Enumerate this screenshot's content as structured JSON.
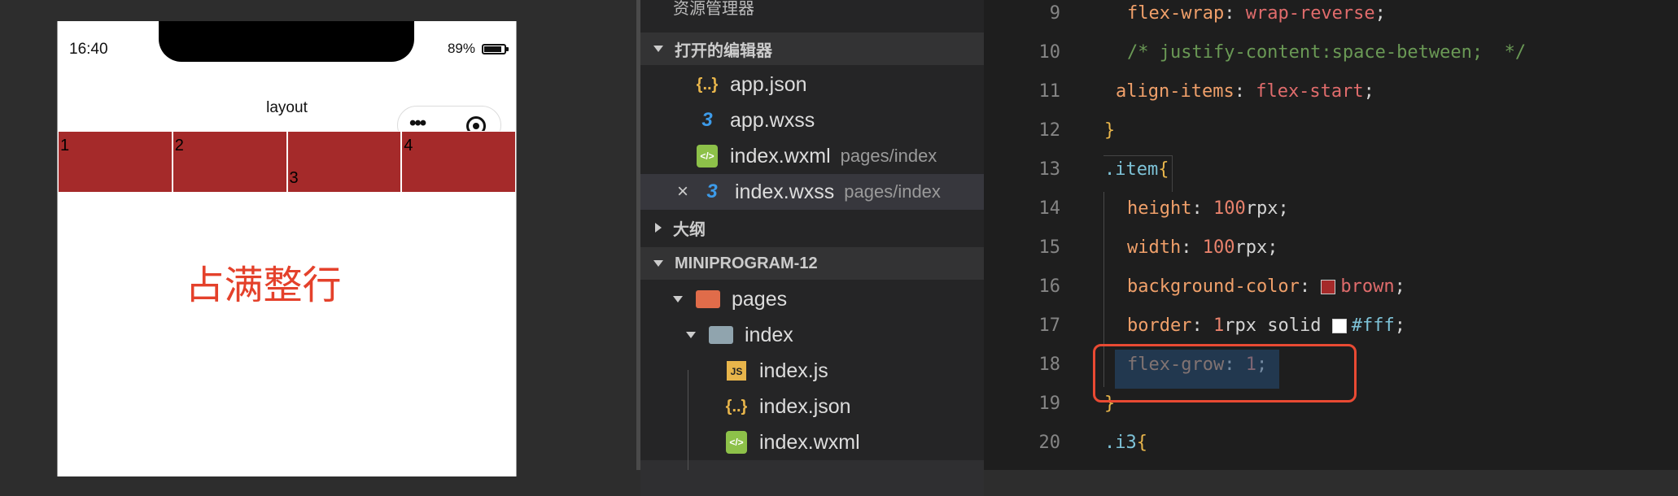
{
  "simulator": {
    "time": "16:40",
    "battery": "89%",
    "title": "layout",
    "items": [
      "1",
      "2",
      "3",
      "4"
    ],
    "caption": "占满整行",
    "colors": {
      "item_bg": "#a52a2a",
      "caption": "#e4412b"
    }
  },
  "explorer": {
    "title": "资源管理器",
    "open_editors_label": "打开的编辑器",
    "open_editors": [
      {
        "icon": "json-icon",
        "name": "app.json",
        "path": ""
      },
      {
        "icon": "css-icon",
        "name": "app.wxss",
        "path": ""
      },
      {
        "icon": "wxml-icon",
        "name": "index.wxml",
        "path": "pages/index"
      },
      {
        "icon": "css-icon",
        "name": "index.wxss",
        "path": "pages/index"
      }
    ],
    "outline_label": "大纲",
    "project_label": "MINIPROGRAM-12",
    "tree": {
      "pages": "pages",
      "index": "index",
      "files": [
        "index.js",
        "index.json",
        "index.wxml"
      ]
    }
  },
  "editor": {
    "lines": [
      {
        "n": "9",
        "code": "flex-wrap: wrap-reverse;"
      },
      {
        "n": "10",
        "code": "/* justify-content:space-between;  */"
      },
      {
        "n": "11",
        "code": "align-items: flex-start;"
      },
      {
        "n": "12",
        "code": "}"
      },
      {
        "n": "13",
        "code": ".item{"
      },
      {
        "n": "14",
        "code": "height: 100rpx;"
      },
      {
        "n": "15",
        "code": "width: 100rpx;"
      },
      {
        "n": "16",
        "code": "background-color: brown;"
      },
      {
        "n": "17",
        "code": "border: 1rpx solid #fff;"
      },
      {
        "n": "18",
        "code": "flex-grow: 1;"
      },
      {
        "n": "19",
        "code": "}"
      },
      {
        "n": "20",
        "code": ".i3{"
      }
    ],
    "tokens": {
      "l9_prop": "flex-wrap",
      "l9_val": "wrap-reverse",
      "l10": "/* justify-content:space-between;  */",
      "l11_prop": "align-items",
      "l11_val": "flex-start",
      "l13_sel": ".item",
      "l14_prop": "height",
      "l14_num": "100",
      "l14_unit": "rpx",
      "l15_prop": "width",
      "l15_num": "100",
      "l15_unit": "rpx",
      "l16_prop": "background-color",
      "l16_val": "brown",
      "l17_prop": "border",
      "l17_num": "1",
      "l17_rest": "rpx solid",
      "l17_val": "#fff",
      "l18_prop": "flex-grow",
      "l18_num": "1",
      "l20_sel": ".i3"
    },
    "colors": {
      "highlight_box": "#e94a33",
      "brown_swatch": "#a52a2a",
      "white_swatch": "#ffffff"
    }
  }
}
